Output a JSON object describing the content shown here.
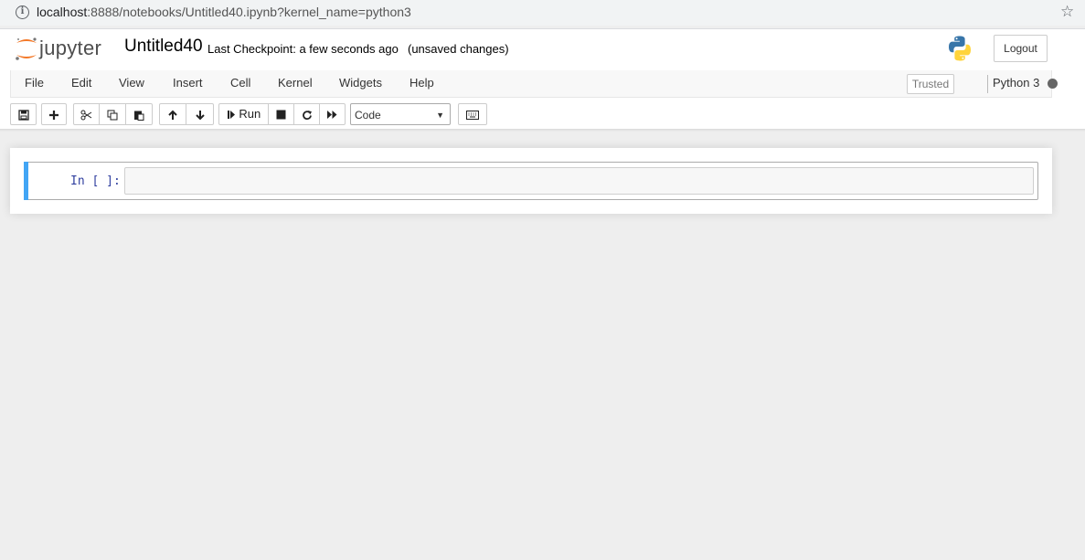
{
  "browser": {
    "url_host": "localhost",
    "url_rest": ":8888/notebooks/Untitled40.ipynb?kernel_name=python3"
  },
  "header": {
    "logo_text": "jupyter",
    "notebook_name": "Untitled40",
    "checkpoint_text": "Last Checkpoint: a few seconds ago",
    "unsaved_text": "(unsaved changes)",
    "logout_label": "Logout"
  },
  "menu": {
    "items": [
      "File",
      "Edit",
      "View",
      "Insert",
      "Cell",
      "Kernel",
      "Widgets",
      "Help"
    ],
    "trusted_label": "Trusted",
    "kernel_name": "Python 3"
  },
  "toolbar": {
    "icons": [
      "save-icon",
      "plus-icon",
      "scissors-icon",
      "copy-icon",
      "paste-icon",
      "arrow-up-icon",
      "arrow-down-icon",
      "step-forward-icon",
      "stop-icon",
      "refresh-icon",
      "fast-forward-icon",
      "keyboard-icon"
    ],
    "run_label": "Run",
    "cell_type_value": "Code"
  },
  "cells": [
    {
      "prompt": "In [ ]:",
      "source": ""
    }
  ],
  "colors": {
    "selected_cell_bar": "#42a5f5",
    "prompt_color": "#303f9f",
    "jupyter_orange": "#f37726"
  }
}
